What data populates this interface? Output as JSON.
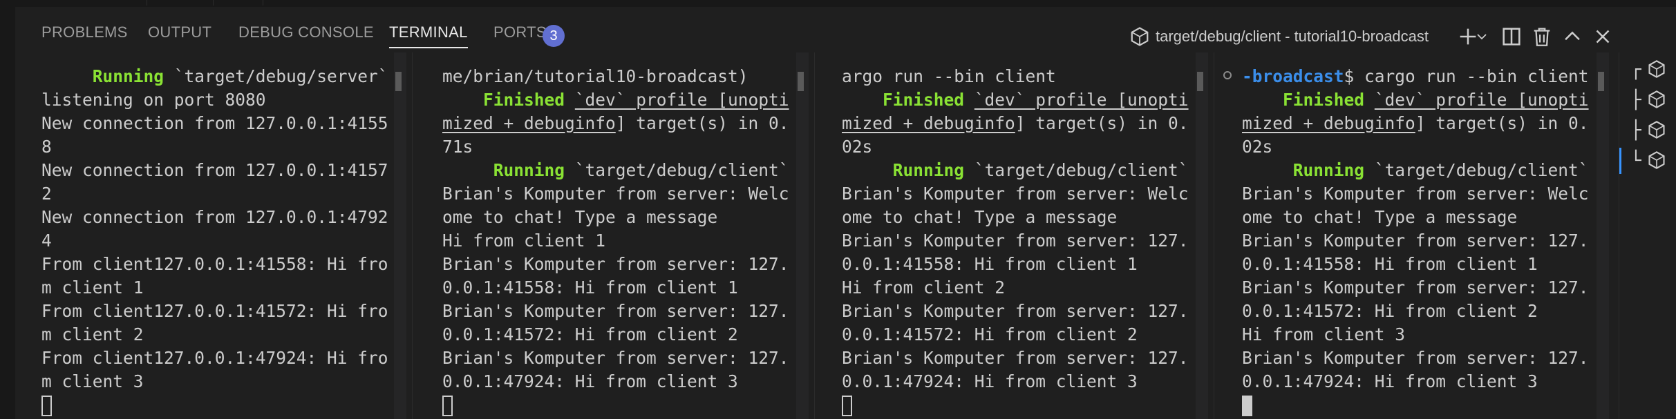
{
  "panel": {
    "tabs": [
      {
        "label": "PROBLEMS"
      },
      {
        "label": "OUTPUT"
      },
      {
        "label": "DEBUG CONSOLE"
      },
      {
        "label": "TERMINAL",
        "active": true
      },
      {
        "label": "PORTS",
        "badge": "3"
      }
    ],
    "terminal_title": "target/debug/client - tutorial10-broadcast"
  },
  "terminals": [
    {
      "lines": [
        [
          {
            "t": "     "
          },
          {
            "t": "Running",
            "s": "g"
          },
          {
            "t": " `target/debug/server`"
          }
        ],
        [
          {
            "t": "listening on port 8080"
          }
        ],
        [
          {
            "t": "New connection from 127.0.0.1:4155"
          }
        ],
        [
          {
            "t": "8"
          }
        ],
        [
          {
            "t": "New connection from 127.0.0.1:4157"
          }
        ],
        [
          {
            "t": "2"
          }
        ],
        [
          {
            "t": "New connection from 127.0.0.1:4792"
          }
        ],
        [
          {
            "t": "4"
          }
        ],
        [
          {
            "t": "From client127.0.0.1:41558: Hi fro"
          }
        ],
        [
          {
            "t": "m client 1"
          }
        ],
        [
          {
            "t": "From client127.0.0.1:41572: Hi fro"
          }
        ],
        [
          {
            "t": "m client 2"
          }
        ],
        [
          {
            "t": "From client127.0.0.1:47924: Hi fro"
          }
        ],
        [
          {
            "t": "m client 3"
          }
        ]
      ]
    },
    {
      "lines": [
        [
          {
            "t": "me/brian/tutorial10-broadcast)"
          }
        ],
        [
          {
            "t": "    "
          },
          {
            "t": "Finished",
            "s": "g"
          },
          {
            "t": " "
          },
          {
            "t": "`dev` profile [unopti",
            "s": "u"
          }
        ],
        [
          {
            "t": "mized + debuginfo",
            "s": "u"
          },
          {
            "t": "] target(s) in 0."
          }
        ],
        [
          {
            "t": "71s"
          }
        ],
        [
          {
            "t": "     "
          },
          {
            "t": "Running",
            "s": "g"
          },
          {
            "t": " `target/debug/client`"
          }
        ],
        [
          {
            "t": "Brian's Komputer from server: Welc"
          }
        ],
        [
          {
            "t": "ome to chat! Type a message"
          }
        ],
        [
          {
            "t": "Hi from client 1"
          }
        ],
        [
          {
            "t": "Brian's Komputer from server: 127."
          }
        ],
        [
          {
            "t": "0.0.1:41558: Hi from client 1"
          }
        ],
        [
          {
            "t": "Brian's Komputer from server: 127."
          }
        ],
        [
          {
            "t": "0.0.1:41572: Hi from client 2"
          }
        ],
        [
          {
            "t": "Brian's Komputer from server: 127."
          }
        ],
        [
          {
            "t": "0.0.1:47924: Hi from client 3"
          }
        ]
      ]
    },
    {
      "lines": [
        [
          {
            "t": "argo run --bin client"
          }
        ],
        [
          {
            "t": "    "
          },
          {
            "t": "Finished",
            "s": "g"
          },
          {
            "t": " "
          },
          {
            "t": "`dev` profile [unopti",
            "s": "u"
          }
        ],
        [
          {
            "t": "mized + debuginfo",
            "s": "u"
          },
          {
            "t": "] target(s) in 0."
          }
        ],
        [
          {
            "t": "02s"
          }
        ],
        [
          {
            "t": "     "
          },
          {
            "t": "Running",
            "s": "g"
          },
          {
            "t": " `target/debug/client`"
          }
        ],
        [
          {
            "t": "Brian's Komputer from server: Welc"
          }
        ],
        [
          {
            "t": "ome to chat! Type a message"
          }
        ],
        [
          {
            "t": "Brian's Komputer from server: 127."
          }
        ],
        [
          {
            "t": "0.0.1:41558: Hi from client 1"
          }
        ],
        [
          {
            "t": "Hi from client 2"
          }
        ],
        [
          {
            "t": "Brian's Komputer from server: 127."
          }
        ],
        [
          {
            "t": "0.0.1:41572: Hi from client 2"
          }
        ],
        [
          {
            "t": "Brian's Komputer from server: 127."
          }
        ],
        [
          {
            "t": "0.0.1:47924: Hi from client 3"
          }
        ]
      ]
    },
    {
      "lines": [
        [
          {
            "t": "-broadcast",
            "s": "b"
          },
          {
            "t": "$ cargo run --bin client"
          }
        ],
        [
          {
            "t": "    "
          },
          {
            "t": "Finished",
            "s": "g"
          },
          {
            "t": " "
          },
          {
            "t": "`dev` profile [unopti",
            "s": "u"
          }
        ],
        [
          {
            "t": "mized + debuginfo",
            "s": "u"
          },
          {
            "t": "] target(s) in 0."
          }
        ],
        [
          {
            "t": "02s"
          }
        ],
        [
          {
            "t": "     "
          },
          {
            "t": "Running",
            "s": "g"
          },
          {
            "t": " `target/debug/client`"
          }
        ],
        [
          {
            "t": "Brian's Komputer from server: Welc"
          }
        ],
        [
          {
            "t": "ome to chat! Type a message"
          }
        ],
        [
          {
            "t": "Brian's Komputer from server: 127."
          }
        ],
        [
          {
            "t": "0.0.1:41558: Hi from client 1"
          }
        ],
        [
          {
            "t": "Brian's Komputer from server: 127."
          }
        ],
        [
          {
            "t": "0.0.1:41572: Hi from client 2"
          }
        ],
        [
          {
            "t": "Hi from client 3"
          }
        ],
        [
          {
            "t": "Brian's Komputer from server: 127."
          }
        ],
        [
          {
            "t": "0.0.1:47924: Hi from client 3"
          }
        ]
      ]
    }
  ],
  "terminal_list": {
    "tree_glyphs": [
      "┌",
      "├",
      "├",
      "└"
    ],
    "icon": "terminal-icon"
  },
  "colors": {
    "background": "#1f1f1f",
    "text": "#cccccc",
    "success_green": "#8ae234",
    "prompt_blue": "#3b8eea",
    "badge": "#616fd1",
    "active_indicator": "#3794ff"
  },
  "icons": [
    "terminal-icon",
    "plus-icon",
    "chevron-down-icon",
    "split-icon",
    "trash-icon",
    "chevron-up-icon",
    "close-icon"
  ]
}
